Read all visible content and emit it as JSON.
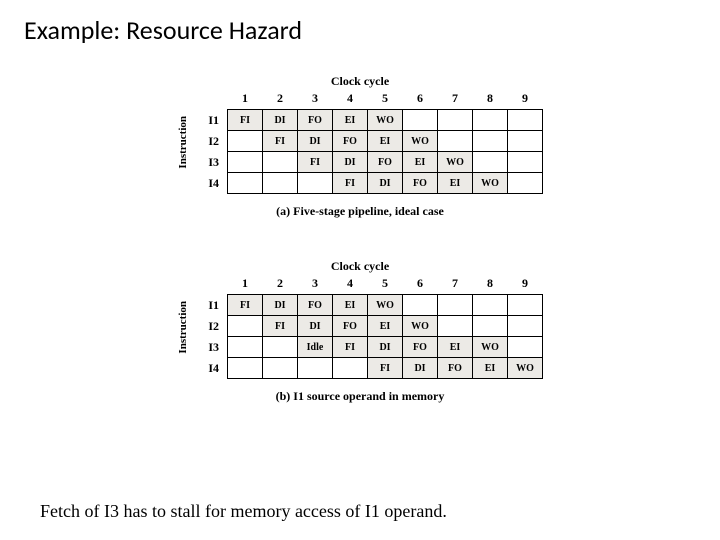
{
  "title": "Example: Resource Hazard",
  "labels": {
    "clock": "Clock cycle",
    "instruction": "Instruction"
  },
  "cycles": [
    "1",
    "2",
    "3",
    "4",
    "5",
    "6",
    "7",
    "8",
    "9"
  ],
  "row_ids": [
    "I1",
    "I2",
    "I3",
    "I4"
  ],
  "stages": {
    "FI": "FI",
    "DI": "DI",
    "FO": "FO",
    "EI": "EI",
    "WO": "WO",
    "Idle": "Idle"
  },
  "table_a": {
    "caption": "(a) Five-stage pipeline, ideal case",
    "rows": [
      [
        "FI",
        "DI",
        "FO",
        "EI",
        "WO",
        "",
        "",
        "",
        ""
      ],
      [
        "",
        "FI",
        "DI",
        "FO",
        "EI",
        "WO",
        "",
        "",
        ""
      ],
      [
        "",
        "",
        "FI",
        "DI",
        "FO",
        "EI",
        "WO",
        "",
        ""
      ],
      [
        "",
        "",
        "",
        "FI",
        "DI",
        "FO",
        "EI",
        "WO",
        ""
      ]
    ]
  },
  "table_b": {
    "caption": "(b) I1 source operand in memory",
    "rows": [
      [
        "FI",
        "DI",
        "FO",
        "EI",
        "WO",
        "",
        "",
        "",
        ""
      ],
      [
        "",
        "FI",
        "DI",
        "FO",
        "EI",
        "WO",
        "",
        "",
        ""
      ],
      [
        "",
        "",
        "Idle",
        "FI",
        "DI",
        "FO",
        "EI",
        "WO",
        ""
      ],
      [
        "",
        "",
        "",
        "",
        "FI",
        "DI",
        "FO",
        "EI",
        "WO"
      ]
    ]
  },
  "footnote": "Fetch of I3 has to stall for memory access of I1 operand."
}
